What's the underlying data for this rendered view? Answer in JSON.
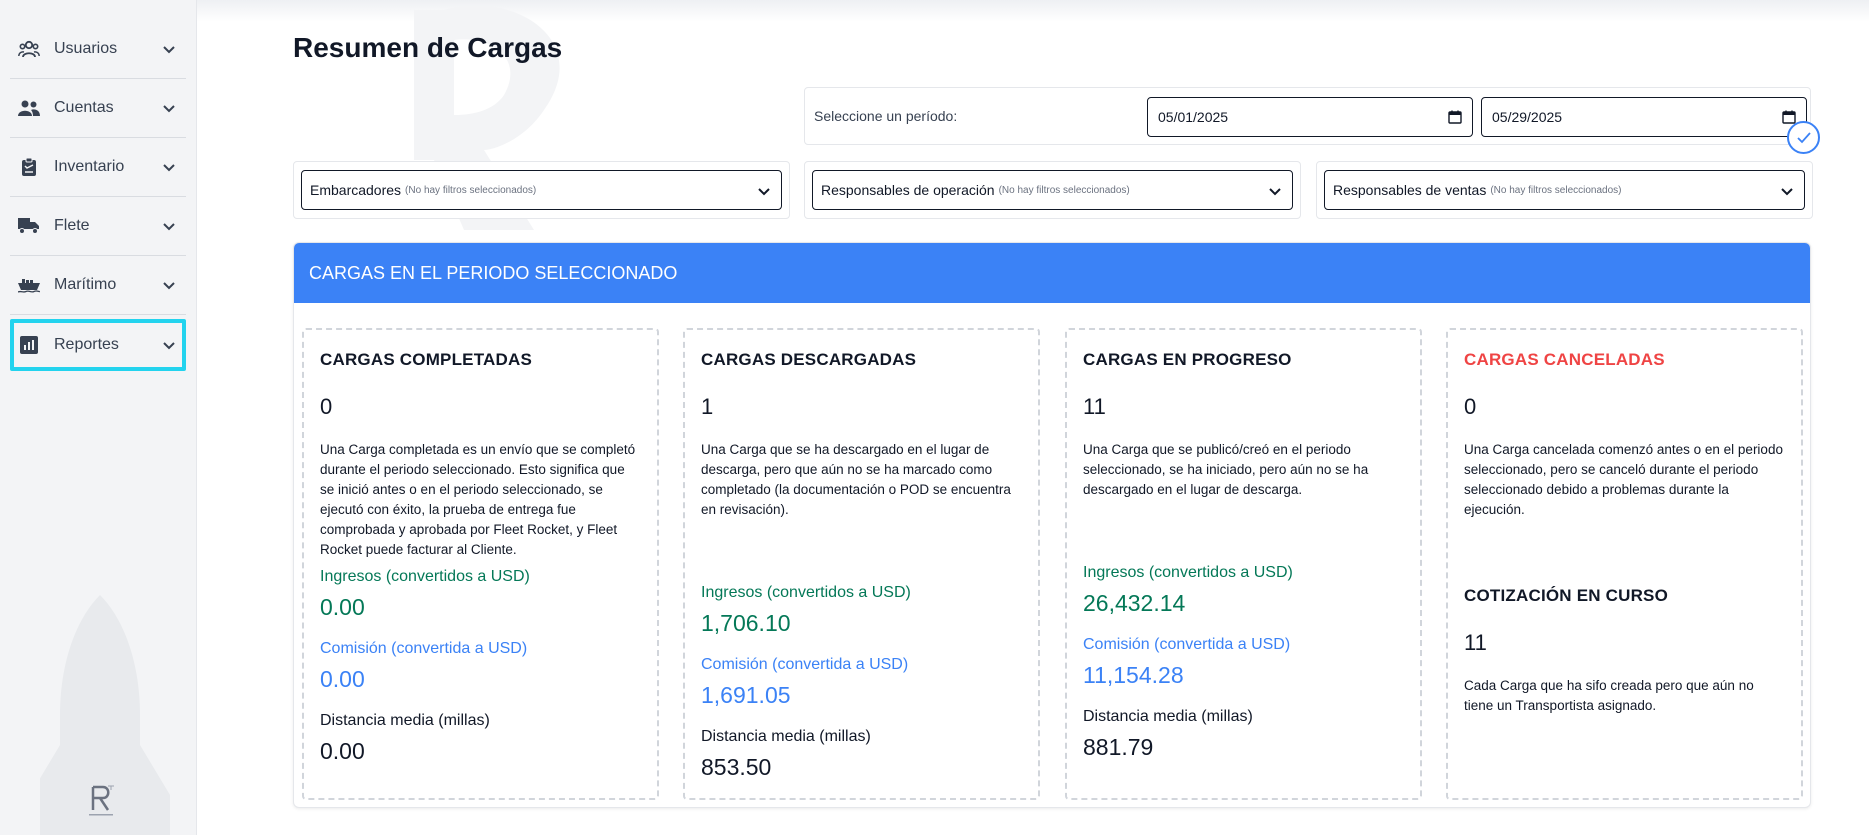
{
  "sidebar": {
    "items": [
      {
        "label": "Usuarios",
        "icon": "users-icon"
      },
      {
        "label": "Cuentas",
        "icon": "accounts-icon"
      },
      {
        "label": "Inventario",
        "icon": "clipboard-icon"
      },
      {
        "label": "Flete",
        "icon": "truck-icon"
      },
      {
        "label": "Marítimo",
        "icon": "ship-icon"
      },
      {
        "label": "Reportes",
        "icon": "chart-icon",
        "active": true
      }
    ]
  },
  "page": {
    "title": "Resumen de Cargas"
  },
  "period": {
    "label": "Seleccione un período:",
    "start": "05/01/2025",
    "end": "05/29/2025"
  },
  "filters": [
    {
      "label": "Embarcadores",
      "hint": "(No hay filtros seleccionados)"
    },
    {
      "label": "Responsables de operación",
      "hint": "(No hay filtros seleccionados)"
    },
    {
      "label": "Responsables de ventas",
      "hint": "(No hay filtros seleccionados)"
    }
  ],
  "panel": {
    "header": "CARGAS EN EL PERIODO SELECCIONADO"
  },
  "cards": {
    "completed": {
      "title": "CARGAS COMPLETADAS",
      "count": "0",
      "desc": "Una Carga completada es un envío que se completó durante el periodo seleccionado. Esto significa que se inició antes o en el periodo seleccionado, se ejecutó con éxito, la prueba de entrega fue comprobada y aprobada por Fleet Rocket, y Fleet Rocket puede facturar al Cliente.",
      "income_label": "Ingresos (convertidos a USD)",
      "income": "0.00",
      "commission_label": "Comisión (convertida a USD)",
      "commission": "0.00",
      "distance_label": "Distancia media (millas)",
      "distance": "0.00"
    },
    "unloaded": {
      "title": "CARGAS DESCARGADAS",
      "count": "1",
      "desc": "Una Carga que se ha descargado en el lugar de descarga, pero que aún no se ha marcado como completado (la documentación o POD se encuentra en revisación).",
      "income_label": "Ingresos (convertidos a USD)",
      "income": "1,706.10",
      "commission_label": "Comisión (convertida a USD)",
      "commission": "1,691.05",
      "distance_label": "Distancia media (millas)",
      "distance": "853.50"
    },
    "in_progress": {
      "title": "CARGAS EN PROGRESO",
      "count": "11",
      "desc": "Una Carga que se publicó/creó en el periodo seleccionado, se ha iniciado, pero aún no se ha descargado en el lugar de descarga.",
      "income_label": "Ingresos (convertidos a USD)",
      "income": "26,432.14",
      "commission_label": "Comisión (convertida a USD)",
      "commission": "11,154.28",
      "distance_label": "Distancia media (millas)",
      "distance": "881.79"
    },
    "cancelled": {
      "title": "CARGAS CANCELADAS",
      "count": "0",
      "desc": "Una Carga cancelada comenzó antes o en el periodo seleccionado, pero se canceló durante el periodo seleccionado debido a problemas durante la ejecución.",
      "quote_title": "COTIZACIÓN EN CURSO",
      "quote_count": "11",
      "quote_desc": "Cada Carga que ha sifo creada pero que aún no tiene un Transportista asignado."
    }
  },
  "colors": {
    "accent": "#3b82f6",
    "highlight": "#22d3ee",
    "income": "#047857",
    "cancel": "#ef4444"
  }
}
